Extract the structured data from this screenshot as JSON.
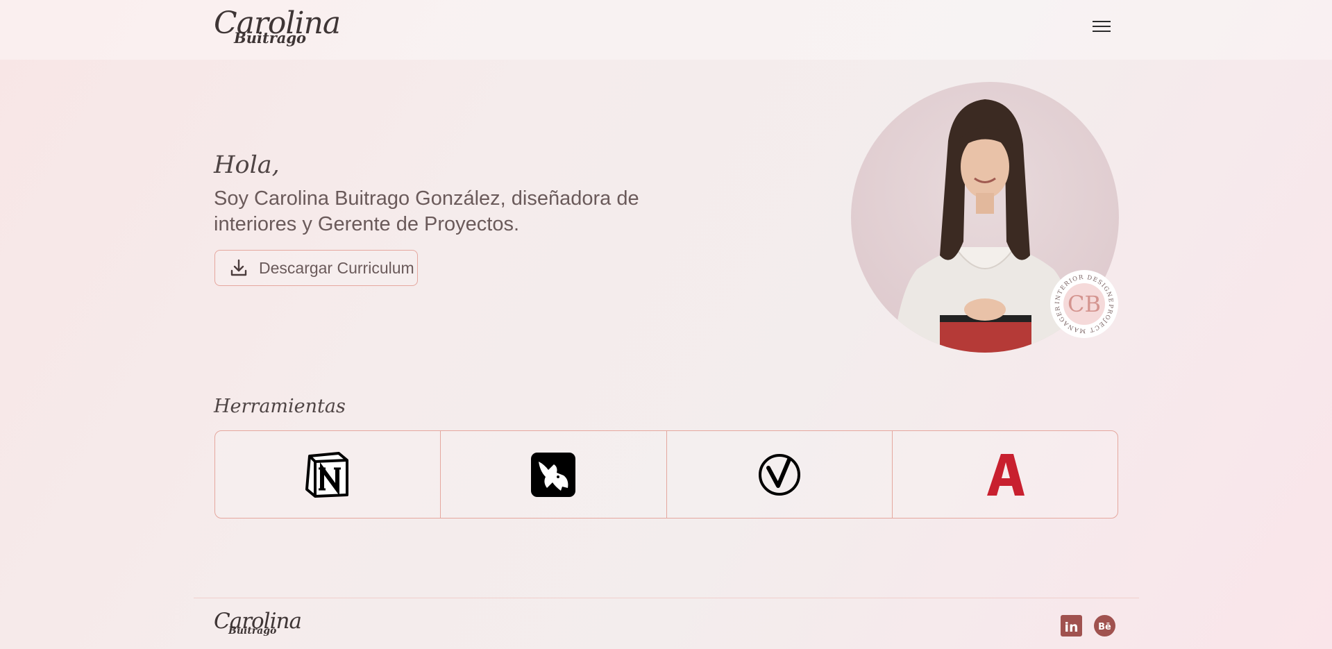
{
  "header": {
    "logo": {
      "line1": "Carolina",
      "line2": "Buitrago"
    },
    "menu_icon": "hamburger-menu-icon"
  },
  "hero": {
    "greeting": "Hola,",
    "intro": "Soy Carolina Buitrago González, diseñadora de interiores y Gerente de Proyectos.",
    "cv_button": {
      "label": "Descargar Curriculum",
      "icon": "download-icon"
    },
    "badge": {
      "text_top": "INTERIOR DESIGNER",
      "text_bottom": "PROJECT MANAGER",
      "monogram": "CB"
    }
  },
  "tools": {
    "title": "Herramientas",
    "items": [
      {
        "name": "Notion",
        "icon": "notion-icon"
      },
      {
        "name": "Rhino",
        "icon": "rhino-icon"
      },
      {
        "name": "V-Ray",
        "icon": "vray-icon"
      },
      {
        "name": "AutoCAD",
        "icon": "autocad-icon"
      }
    ]
  },
  "footer": {
    "logo": {
      "line1": "Carolina",
      "line2": "Buitrago"
    },
    "social": [
      {
        "name": "LinkedIn",
        "icon": "linkedin-icon",
        "glyph": "in"
      },
      {
        "name": "Behance",
        "icon": "behance-icon",
        "glyph": "Bē"
      }
    ]
  },
  "colors": {
    "accent_border": "#e5a79e",
    "social_icon": "#a0524f",
    "autocad_red": "#c8202f",
    "text_dark": "#4e4444"
  }
}
